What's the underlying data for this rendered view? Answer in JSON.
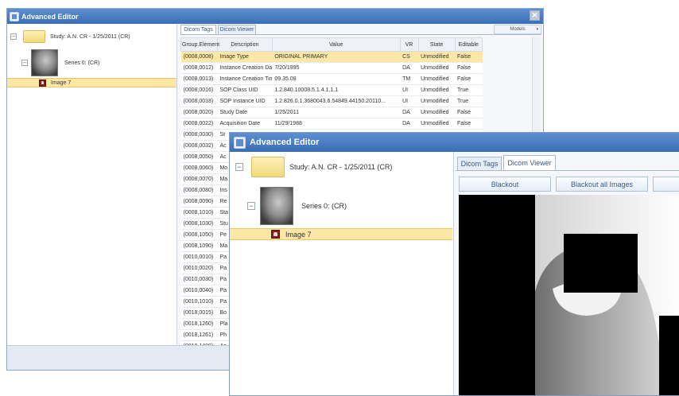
{
  "back_window": {
    "title": "Advanced Editor",
    "tree": {
      "study_label": "Study: A.N. CR - 1/25/2011 (CR)",
      "series_label": "Series 0:  (CR)",
      "image_label": "Image 7"
    },
    "tabs": [
      "Dicom Tags",
      "Dicom Viewer"
    ],
    "models_label": "Models",
    "columns": [
      "Group.Element",
      "Description",
      "Value",
      "VR",
      "State",
      "Editable"
    ],
    "rows": [
      [
        "(0008,0008)",
        "Image Type",
        "ORIGINAL PRIMARY",
        "CS",
        "Unmodified",
        "False"
      ],
      [
        "(0008,0012)",
        "Instance Creation Date",
        "7/20/1995",
        "DA",
        "Unmodified",
        "False"
      ],
      [
        "(0008,0013)",
        "Instance Creation Time",
        "09.35.08",
        "TM",
        "Unmodified",
        "False"
      ],
      [
        "(0008,0016)",
        "SOP Class UID",
        "1.2.840.10008.5.1.4.1.1.1",
        "UI",
        "Unmodified",
        "True"
      ],
      [
        "(0008,0018)",
        "SOP Instance UID",
        "1.2.826.0.1.3680043.6.54849.44150.20110...",
        "UI",
        "Unmodified",
        "True"
      ],
      [
        "(0008,0020)",
        "Study Date",
        "1/25/2011",
        "DA",
        "Unmodified",
        "False"
      ],
      [
        "(0008,0022)",
        "Acquisition Date",
        "11/29/1988",
        "DA",
        "Unmodified",
        "False"
      ],
      [
        "(0008,0030)",
        "St",
        "",
        "",
        "",
        ""
      ],
      [
        "(0008,0032)",
        "Ac",
        "",
        "",
        "",
        ""
      ],
      [
        "(0008,0050)",
        "Ac",
        "",
        "",
        "",
        ""
      ],
      [
        "(0008,0060)",
        "Mo",
        "",
        "",
        "",
        ""
      ],
      [
        "(0008,0070)",
        "Ma",
        "",
        "",
        "",
        ""
      ],
      [
        "(0008,0080)",
        "Ins",
        "",
        "",
        "",
        ""
      ],
      [
        "(0008,0090)",
        "Re",
        "",
        "",
        "",
        ""
      ],
      [
        "(0008,1010)",
        "Sta",
        "",
        "",
        "",
        ""
      ],
      [
        "(0008,1030)",
        "Stu",
        "",
        "",
        "",
        ""
      ],
      [
        "(0008,1050)",
        "Pe",
        "",
        "",
        "",
        ""
      ],
      [
        "(0008,1090)",
        "Ma",
        "",
        "",
        "",
        ""
      ],
      [
        "(0010,0010)",
        "Pa",
        "",
        "",
        "",
        ""
      ],
      [
        "(0010,0020)",
        "Pa",
        "",
        "",
        "",
        ""
      ],
      [
        "(0010,0030)",
        "Pa",
        "",
        "",
        "",
        ""
      ],
      [
        "(0010,0040)",
        "Pa",
        "",
        "",
        "",
        ""
      ],
      [
        "(0010,1010)",
        "Pa",
        "",
        "",
        "",
        ""
      ],
      [
        "(0018,0015)",
        "Bo",
        "",
        "",
        "",
        ""
      ],
      [
        "(0018,1260)",
        "Pla",
        "",
        "",
        "",
        ""
      ],
      [
        "(0018,1261)",
        "Ph",
        "",
        "",
        "",
        ""
      ],
      [
        "(0018,1400)",
        "Ac",
        "",
        "",
        "",
        ""
      ]
    ]
  },
  "front_window": {
    "title": "Advanced Editor",
    "tree": {
      "study_label": "Study: A.N. CR - 1/25/2011 (CR)",
      "series_label": "Series 0:  (CR)",
      "image_label": "Image 7"
    },
    "tabs": [
      "Dicom Tags",
      "Dicom Viewer"
    ],
    "active_tab": "Dicom Viewer",
    "buttons": [
      "Blackout",
      "Blackout all Images"
    ]
  }
}
